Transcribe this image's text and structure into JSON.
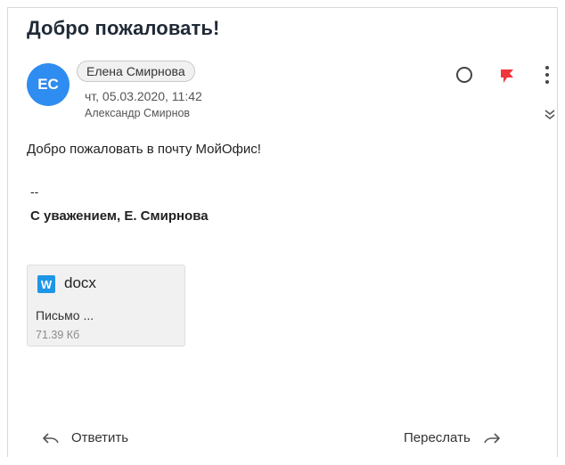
{
  "message": {
    "subject": "Добро пожаловать!",
    "sender": {
      "initials": "ЕС",
      "name": "Елена Смирнова",
      "avatar_color": "#2f8cf0"
    },
    "date": "чт, 05.03.2020, 11:42",
    "recipient": "Александр Смирнов",
    "body": "Добро пожаловать в почту МойОфис!",
    "signature": {
      "separator": "--",
      "name": "С уважением, Е. Смирнова"
    }
  },
  "attachment": {
    "type_icon": "W",
    "extension": "docx",
    "name": "Письмо ...",
    "size": "71.39 Кб",
    "icon_color": "#1e96e6"
  },
  "toolbar": {
    "icons": [
      "mark-unread-circle-icon",
      "flag-icon",
      "more-vertical-icon",
      "expand-double-chevron-icon"
    ],
    "flag_color": "#f0353c"
  },
  "actions": {
    "reply_label": "Ответить",
    "forward_label": "Переслать"
  }
}
